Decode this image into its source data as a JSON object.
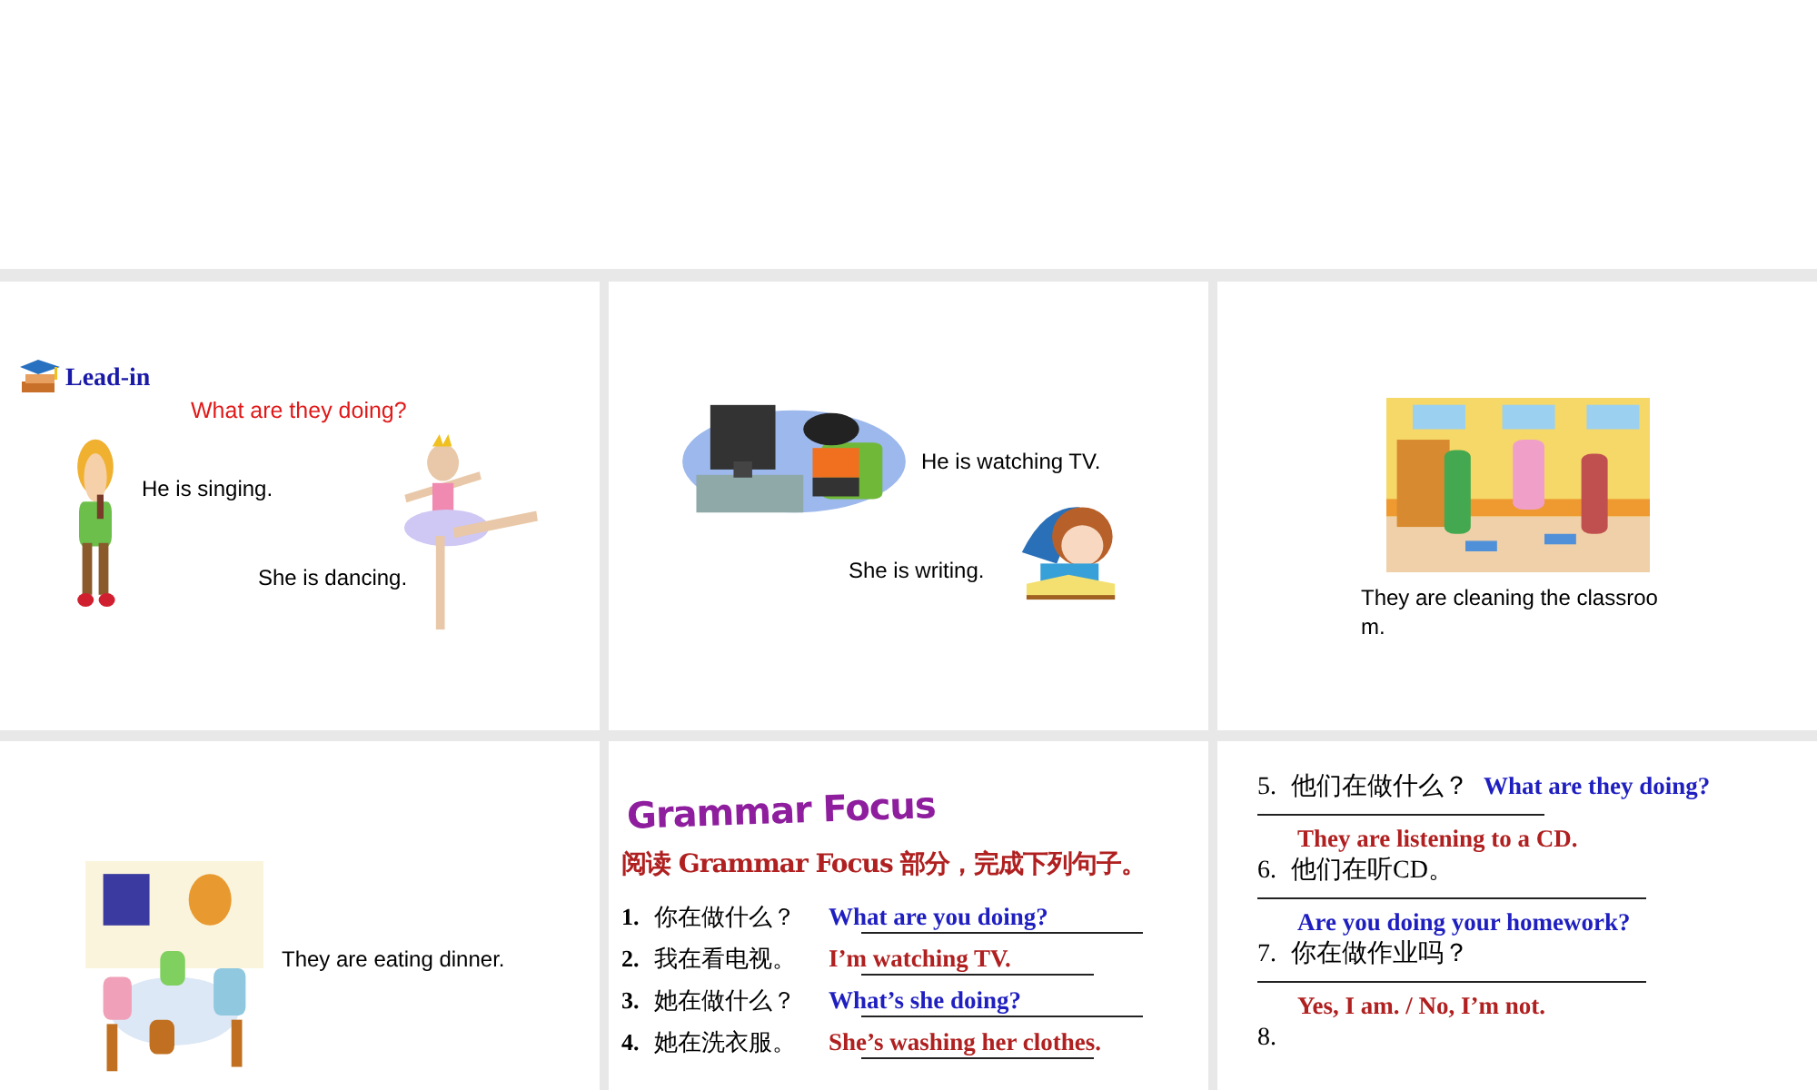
{
  "slides": [
    {
      "kind": "lead_in",
      "heading": "Lead-in",
      "question": "What are they doing?",
      "captions": [
        "He is singing.",
        "She is dancing."
      ]
    },
    {
      "kind": "pair",
      "captions": [
        "He is watching TV.",
        "She is writing."
      ]
    },
    {
      "kind": "caption_below",
      "caption": "They are cleaning the classroom."
    },
    {
      "kind": "caption_right",
      "caption": "They are eating dinner."
    },
    {
      "kind": "grammar",
      "title": "Grammar Focus",
      "instruction": "阅读 Grammar Focus 部分，完成下列句子。",
      "items": [
        {
          "number": "1.",
          "prompt": "你在做什么？",
          "answer": "What are you doing?",
          "color": "#1f1fc0"
        },
        {
          "number": "2.",
          "prompt": "我在看电视。",
          "answer": "I’m watching TV.",
          "color": "#b02020"
        },
        {
          "number": "3.",
          "prompt": "她在做什么？",
          "answer": "What’s she doing?",
          "color": "#1f1fc0"
        },
        {
          "number": "4.",
          "prompt": "她在洗衣服。",
          "answer": "She’s washing her clothes.",
          "color": "#b02020"
        }
      ]
    },
    {
      "kind": "exercise",
      "items": [
        {
          "kind": "inline",
          "number": "5.",
          "prompt": "他们在做什么？",
          "answer": "What are they doing?",
          "color": "#1f1fc0"
        },
        {
          "kind": "overlay",
          "number": "6.",
          "prompt": "他们在听CD。",
          "answer": "They are listening to a CD.",
          "color": "#b02020"
        },
        {
          "kind": "overlay",
          "number": "7.",
          "prompt": "你在做作业吗？",
          "answer": "Are you doing your homework?",
          "color": "#1f1fc0"
        },
        {
          "kind": "overlay",
          "number": "8.",
          "answer": "Yes, I am. / No, I’m not.",
          "color": "#b02020"
        }
      ]
    }
  ]
}
